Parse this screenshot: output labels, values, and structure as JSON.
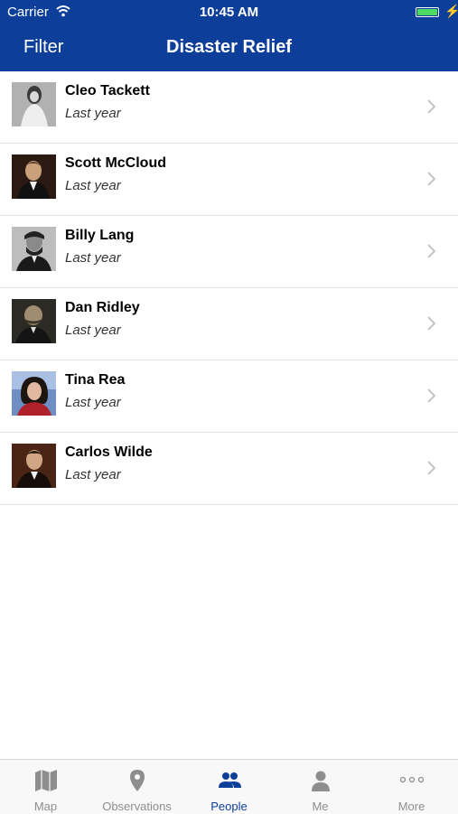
{
  "status_bar": {
    "carrier": "Carrier",
    "time": "10:45 AM",
    "battery_level": 1.0
  },
  "nav": {
    "filter_label": "Filter",
    "title": "Disaster Relief"
  },
  "people": [
    {
      "name": "Cleo Tackett",
      "subtitle": "Last year"
    },
    {
      "name": "Scott McCloud",
      "subtitle": "Last year"
    },
    {
      "name": "Billy Lang",
      "subtitle": "Last year"
    },
    {
      "name": "Dan Ridley",
      "subtitle": "Last year"
    },
    {
      "name": "Tina Rea",
      "subtitle": "Last year"
    },
    {
      "name": "Carlos Wilde",
      "subtitle": "Last year"
    }
  ],
  "tabs": [
    {
      "label": "Map",
      "icon": "map-icon"
    },
    {
      "label": "Observations",
      "icon": "location-pin-icon"
    },
    {
      "label": "People",
      "icon": "people-icon",
      "active": true
    },
    {
      "label": "Me",
      "icon": "person-icon"
    },
    {
      "label": "More",
      "icon": "more-dots-icon"
    }
  ],
  "colors": {
    "nav_bar": "#0d3e99",
    "battery": "#4cd964",
    "tab_active": "#0d3e99",
    "tab_inactive": "#8e8e8e"
  }
}
